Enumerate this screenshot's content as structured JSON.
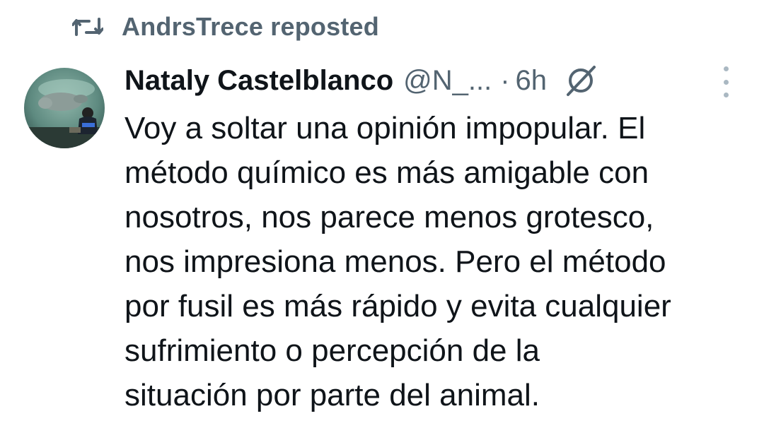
{
  "repost": {
    "icon": "repost-icon",
    "label": "AndrsTrece reposted"
  },
  "tweet": {
    "avatar_icon": "avatar-image",
    "display_name": "Nataly Castelblanco",
    "handle": "@N_...",
    "separator": "·",
    "time": "6h",
    "grok_icon": "grok-icon",
    "more_icon": "more-options-icon",
    "lines": [
      "Voy a soltar una opinión impopular. El",
      "método químico es más amigable con",
      "nosotros, nos parece menos grotesco,",
      "nos impresiona menos. Pero el método",
      "por fusil es más rápido y evita cualquier",
      "sufrimiento o percepción de la",
      "situación por parte del animal."
    ]
  },
  "colors": {
    "primary_text": "#0f1419",
    "secondary_text": "#536471",
    "more_dots": "#aab8c2"
  }
}
